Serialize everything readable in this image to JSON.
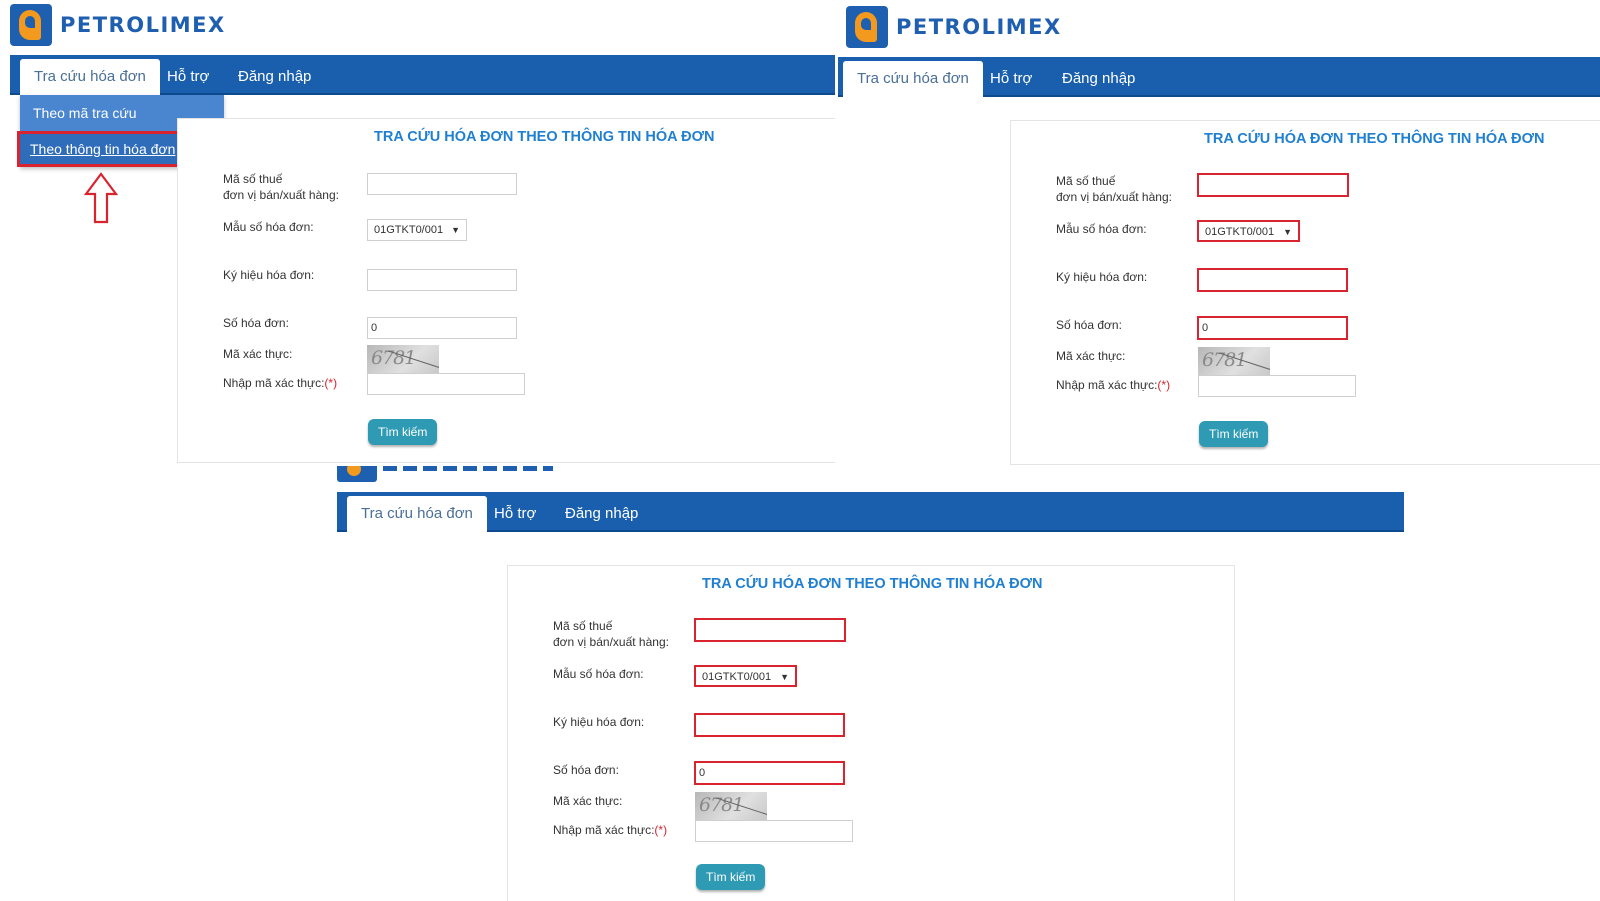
{
  "brand": {
    "name": "PETROLIMEX",
    "color": "#1f5fb0",
    "accent": "#f39a1e"
  },
  "nav": {
    "tab_lookup": "Tra cứu hóa đơn",
    "tab_support": "Hỗ trợ",
    "tab_login": "Đăng nhập",
    "bar_color": "#1a5fad"
  },
  "dropdown": {
    "item_by_code": "Theo mã tra cứu",
    "item_by_info": "Theo thông tin hóa đơn"
  },
  "form": {
    "title": "TRA CỨU HÓA ĐƠN THEO THÔNG TIN HÓA ĐƠN",
    "label_tax_line1": "Mã số thuế",
    "label_tax_line2": "đơn vị bán/xuất hàng:",
    "label_template": "Mẫu số hóa đơn:",
    "template_value": "01GTKT0/001",
    "label_symbol": "Ký hiệu hóa đơn:",
    "label_number": "Số hóa đơn:",
    "number_value": "0",
    "label_captcha": "Mã xác thực:",
    "captcha_text": "6781",
    "label_enter_captcha": "Nhập mã xác thực:",
    "required_mark": "(*)",
    "search_button": "Tìm kiếm",
    "highlight_color": "#d9232e",
    "title_color": "#1f7fd0"
  },
  "annotations": {
    "arrow_icon": "up-arrow-outline-icon"
  }
}
